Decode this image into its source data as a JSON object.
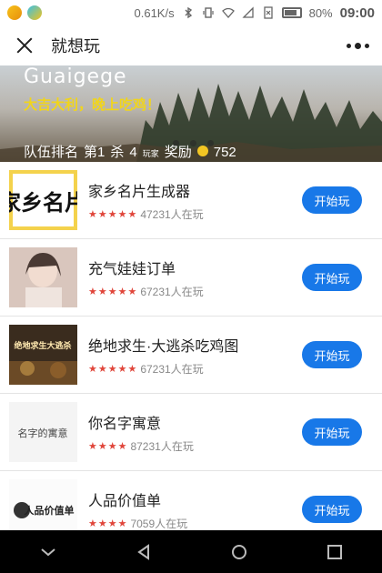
{
  "status_bar": {
    "network_speed": "0.61K/s",
    "battery": "80%",
    "time": "09:00"
  },
  "header": {
    "title": "就想玩"
  },
  "banner": {
    "name": "Guaigege",
    "tagline": "大吉大利，晚上吃鸡！",
    "rank_label": "队伍排名",
    "rank_value": "第1",
    "kills_label": "杀",
    "kills_value": "4",
    "kills_unit": "玩家",
    "reward_label": "奖励",
    "reward_value": "752"
  },
  "list": {
    "items": [
      {
        "title": "家乡名片生成器",
        "players": "47231人在玩",
        "button": "开始玩",
        "stars": "★★★★★",
        "thumb_text": "家乡名片"
      },
      {
        "title": "充气娃娃订单",
        "players": "67231人在玩",
        "button": "开始玩",
        "stars": "★★★★★",
        "thumb_text": ""
      },
      {
        "title": "绝地求生·大逃杀吃鸡图",
        "players": "67231人在玩",
        "button": "开始玩",
        "stars": "★★★★★",
        "thumb_text": "绝地求生大逃杀"
      },
      {
        "title": "你名字寓意",
        "players": "87231人在玩",
        "button": "开始玩",
        "stars": "★★★★",
        "thumb_text": "名字的寓意"
      },
      {
        "title": "人品价值单",
        "players": "7059人在玩",
        "button": "开始玩",
        "stars": "★★★★",
        "thumb_text": "人品价值单"
      }
    ]
  },
  "icons": {
    "close": "close-icon",
    "more": "more-icon",
    "back": "back-icon",
    "home": "home-icon",
    "recents": "recents-icon",
    "hide_keyboard": "chevron-down-icon"
  },
  "colors": {
    "accent": "#1878e8",
    "star": "#e0463b",
    "banner_tag": "#f1d51b"
  }
}
